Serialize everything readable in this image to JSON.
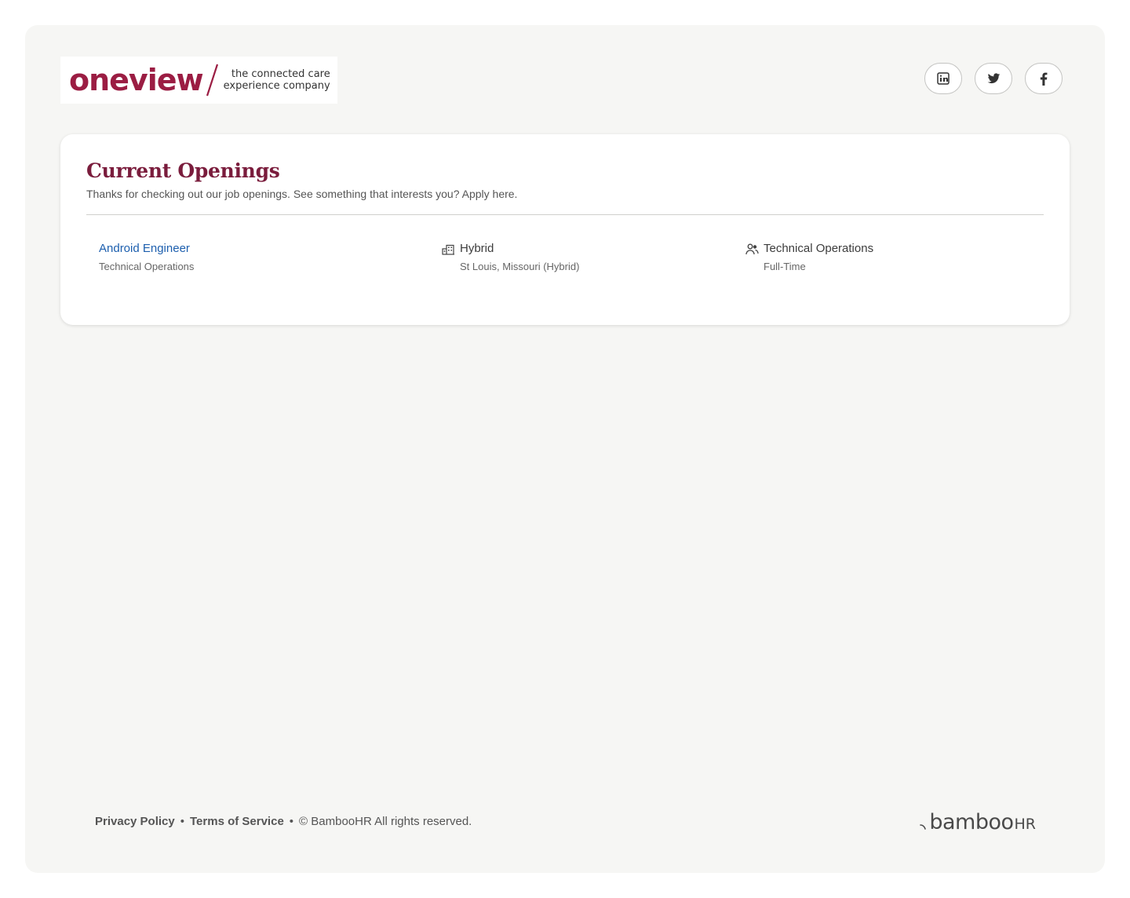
{
  "header": {
    "logo": {
      "word": "oneview",
      "tagline_line1": "the connected care",
      "tagline_line2": "experience company"
    },
    "social": [
      {
        "name": "linkedin",
        "icon": "linkedin-icon"
      },
      {
        "name": "twitter",
        "icon": "twitter-icon"
      },
      {
        "name": "facebook",
        "icon": "facebook-icon"
      }
    ]
  },
  "main": {
    "title": "Current Openings",
    "subtitle": "Thanks for checking out our job openings. See something that interests you? Apply here.",
    "jobs": [
      {
        "title": "Android Engineer",
        "department": "Technical Operations",
        "location_type": "Hybrid",
        "location": "St Louis, Missouri (Hybrid)",
        "team": "Technical Operations",
        "employment_type": "Full-Time"
      }
    ]
  },
  "footer": {
    "privacy": "Privacy Policy",
    "separator": "•",
    "terms": "Terms of Service",
    "copyright": "© BambooHR All rights reserved.",
    "brand_word": "bamboo",
    "brand_suffix": "HR"
  },
  "colors": {
    "brand": "#9b1d43",
    "title": "#7a1c3c",
    "link": "#1d5fae",
    "background": "#f6f6f4"
  }
}
